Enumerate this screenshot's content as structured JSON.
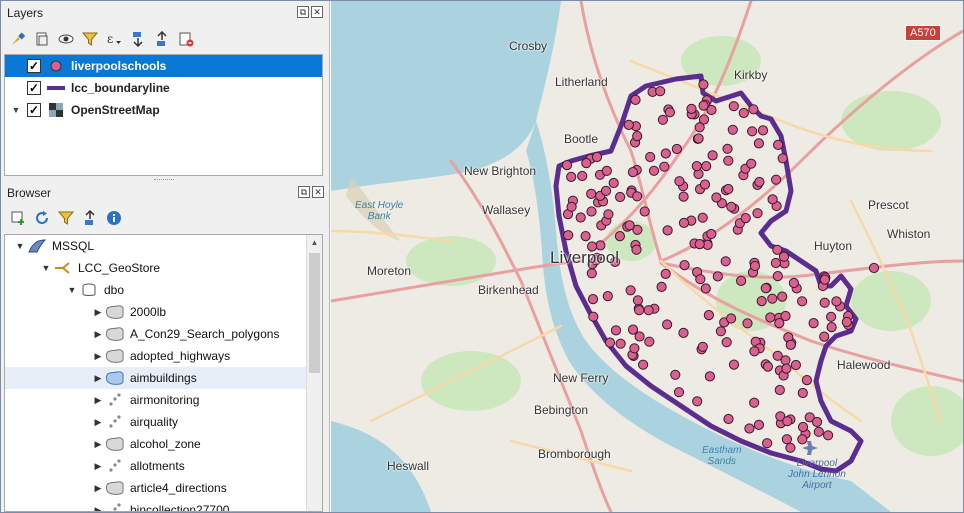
{
  "layers_panel": {
    "title": "Layers",
    "layers": [
      {
        "label": "liverpoolschools",
        "checked": true,
        "selected": true,
        "symbol": "point"
      },
      {
        "label": "lcc_boundaryline",
        "checked": true,
        "selected": false,
        "symbol": "line"
      },
      {
        "label": "OpenStreetMap",
        "checked": true,
        "selected": false,
        "symbol": "raster"
      }
    ],
    "checkmark": "✓"
  },
  "browser_panel": {
    "title": "Browser",
    "tree": [
      {
        "label": "MSSQL",
        "level": 0,
        "expanded": true,
        "icon": "mssql-icon"
      },
      {
        "label": "LCC_GeoStore",
        "level": 1,
        "expanded": true,
        "icon": "connection-icon"
      },
      {
        "label": "dbo",
        "level": 2,
        "expanded": true,
        "icon": "schema-icon"
      },
      {
        "label": "2000lb",
        "level": 3,
        "icon": "polygon-layer-icon"
      },
      {
        "label": "A_Con29_Search_polygons",
        "level": 3,
        "icon": "polygon-layer-icon"
      },
      {
        "label": "adopted_highways",
        "level": 3,
        "icon": "polygon-layer-icon"
      },
      {
        "label": "aimbuildings",
        "level": 3,
        "icon": "polygon-layer-icon",
        "hover": true
      },
      {
        "label": "airmonitoring",
        "level": 3,
        "icon": "point-layer-icon"
      },
      {
        "label": "airquality",
        "level": 3,
        "icon": "point-layer-icon"
      },
      {
        "label": "alcohol_zone",
        "level": 3,
        "icon": "polygon-layer-icon"
      },
      {
        "label": "allotments",
        "level": 3,
        "icon": "point-layer-icon"
      },
      {
        "label": "article4_directions",
        "level": 3,
        "icon": "polygon-layer-icon"
      },
      {
        "label": "bincollection27700",
        "level": 3,
        "icon": "point-layer-icon"
      }
    ]
  },
  "map": {
    "labels": {
      "crosby": "Crosby",
      "kirkby": "Kirkby",
      "litherland": "Litherland",
      "bootle": "Bootle",
      "new_brighton": "New Brighton",
      "wallasey": "Wallasey",
      "east_hoyle_bank": "East Hoyle\nBank",
      "liverpool": "Liverpool",
      "moreton": "Moreton",
      "birkenhead": "Birkenhead",
      "prescot": "Prescot",
      "whiston": "Whiston",
      "huyton": "Huyton",
      "halewood": "Halewood",
      "new_ferry": "New Ferry",
      "bebington": "Bebington",
      "heswall": "Heswall",
      "bromborough": "Bromborough",
      "eastham_sands": "Eastham\nSands",
      "airport": "Liverpool\nJohn Lennon\nAirport",
      "a570": "A570"
    },
    "colors": {
      "land": "#eeebe4",
      "water": "#aad3df",
      "boundary": "#5b2d8e",
      "school_fill": "#d9608f",
      "school_stroke": "#3a1a2a",
      "road_major": "#e8a0a0",
      "road_minor": "#f7d9a8",
      "green": "#cde8bf"
    }
  }
}
